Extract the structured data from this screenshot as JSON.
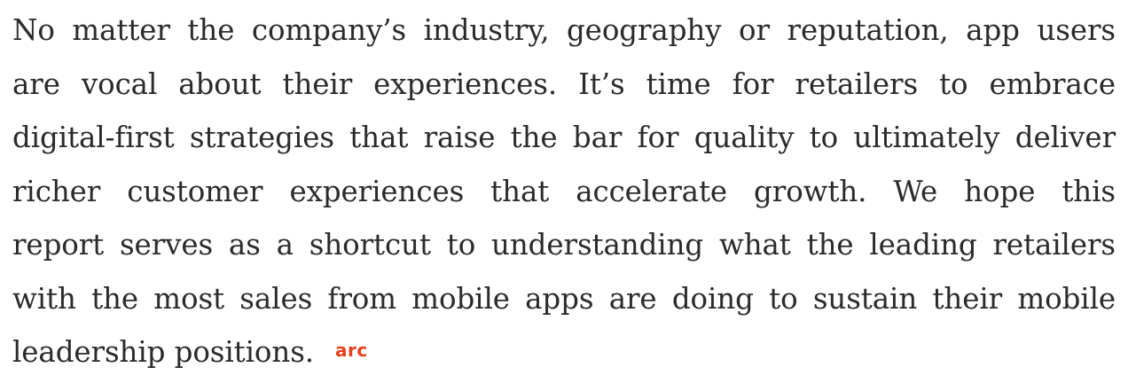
{
  "article": {
    "lines": [
      "No matter the company’s industry, geography or reputation, app users",
      "are vocal about their experiences. It’s time for retailers to embrace",
      "digital-first strategies that raise the bar for quality to ultimately deliver",
      "richer customer experiences that accelerate growth. We hope this",
      "report serves as a shortcut to understanding what the leading retailers",
      "with the most sales from mobile apps are doing to sustain their mobile",
      "leadership positions."
    ],
    "end_mark": "arc",
    "end_mark_color": "#e8401c"
  }
}
